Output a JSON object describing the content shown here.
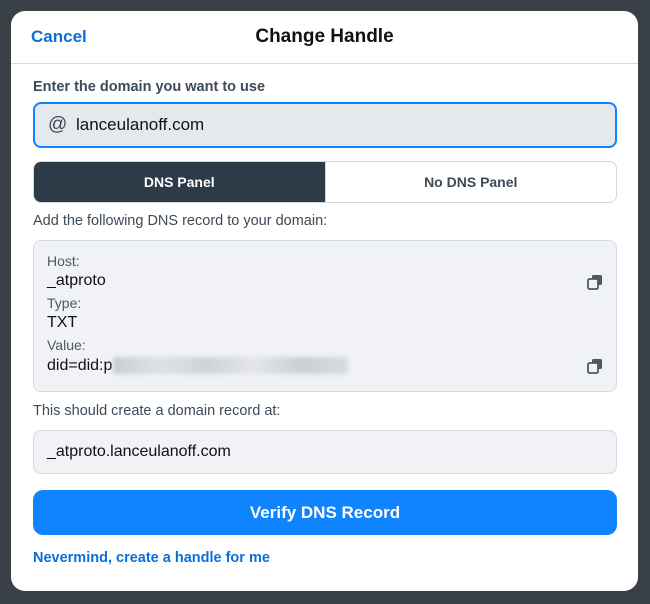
{
  "header": {
    "cancel_label": "Cancel",
    "title": "Change Handle"
  },
  "domain": {
    "label": "Enter the domain you want to use",
    "at_symbol": "@",
    "value": "lanceulanoff.com"
  },
  "toggle": {
    "options": [
      "DNS Panel",
      "No DNS Panel"
    ],
    "selected": "DNS Panel"
  },
  "dns": {
    "instruction": "Add the following DNS record to your domain:",
    "host_label": "Host:",
    "host_value": "_atproto",
    "type_label": "Type:",
    "type_value": "TXT",
    "value_label": "Value:",
    "value_value": "did=did:p"
  },
  "record_at": {
    "label": "This should create a domain record at:",
    "value": "_atproto.lanceulanoff.com"
  },
  "verify_label": "Verify DNS Record",
  "nevermind_label": "Nevermind, create a handle for me",
  "colors": {
    "accent": "#1083fe",
    "link": "#0b6fd8",
    "active_toggle": "#2d3a48"
  }
}
